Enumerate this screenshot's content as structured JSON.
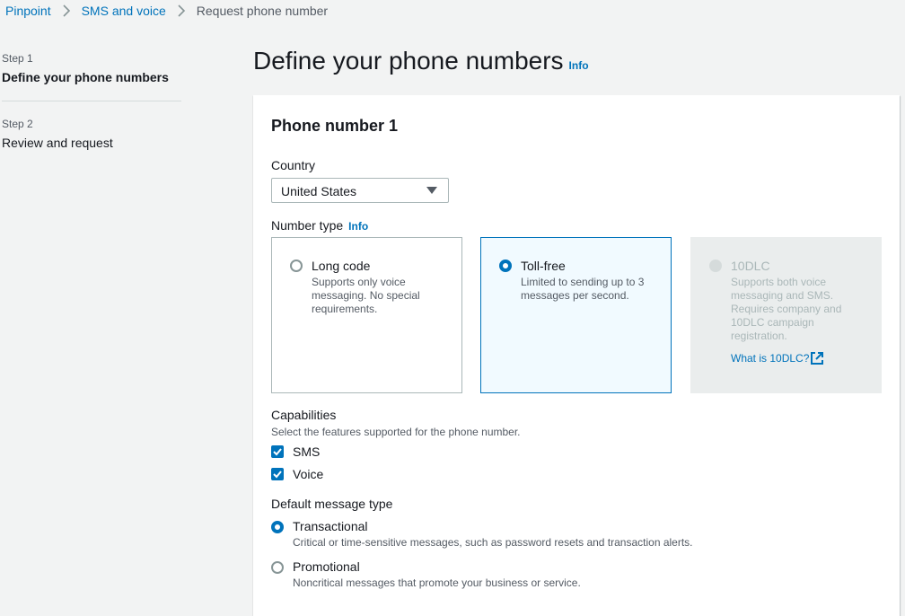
{
  "breadcrumb": {
    "items": [
      "Pinpoint",
      "SMS and voice"
    ],
    "current": "Request phone number"
  },
  "steps": [
    {
      "num": "Step 1",
      "title": "Define your phone numbers"
    },
    {
      "num": "Step 2",
      "title": "Review and request"
    }
  ],
  "page": {
    "title": "Define your phone numbers",
    "info": "Info"
  },
  "panel": {
    "title": "Phone number 1",
    "country": {
      "label": "Country",
      "value": "United States"
    },
    "number_type": {
      "label": "Number type",
      "info": "Info",
      "options": [
        {
          "title": "Long code",
          "desc": "Supports only voice messaging. No special requirements."
        },
        {
          "title": "Toll-free",
          "desc": "Limited to sending up to 3 messages per second."
        },
        {
          "title": "10DLC",
          "desc": "Supports both voice messaging and SMS. Requires company and 10DLC campaign registration.",
          "link": "What is 10DLC?"
        }
      ],
      "selected": "Toll-free"
    },
    "capabilities": {
      "label": "Capabilities",
      "desc": "Select the features supported for the phone number.",
      "options": [
        {
          "label": "SMS",
          "checked": true
        },
        {
          "label": "Voice",
          "checked": true
        }
      ]
    },
    "message_type": {
      "label": "Default message type",
      "options": [
        {
          "label": "Transactional",
          "desc": "Critical or time-sensitive messages, such as password resets and transaction alerts."
        },
        {
          "label": "Promotional",
          "desc": "Noncritical messages that promote your business or service."
        }
      ],
      "selected": "Transactional"
    }
  },
  "colors": {
    "accent": "#0073bb",
    "text": "#16191f",
    "muted": "#545b64",
    "background": "#f2f3f3"
  }
}
